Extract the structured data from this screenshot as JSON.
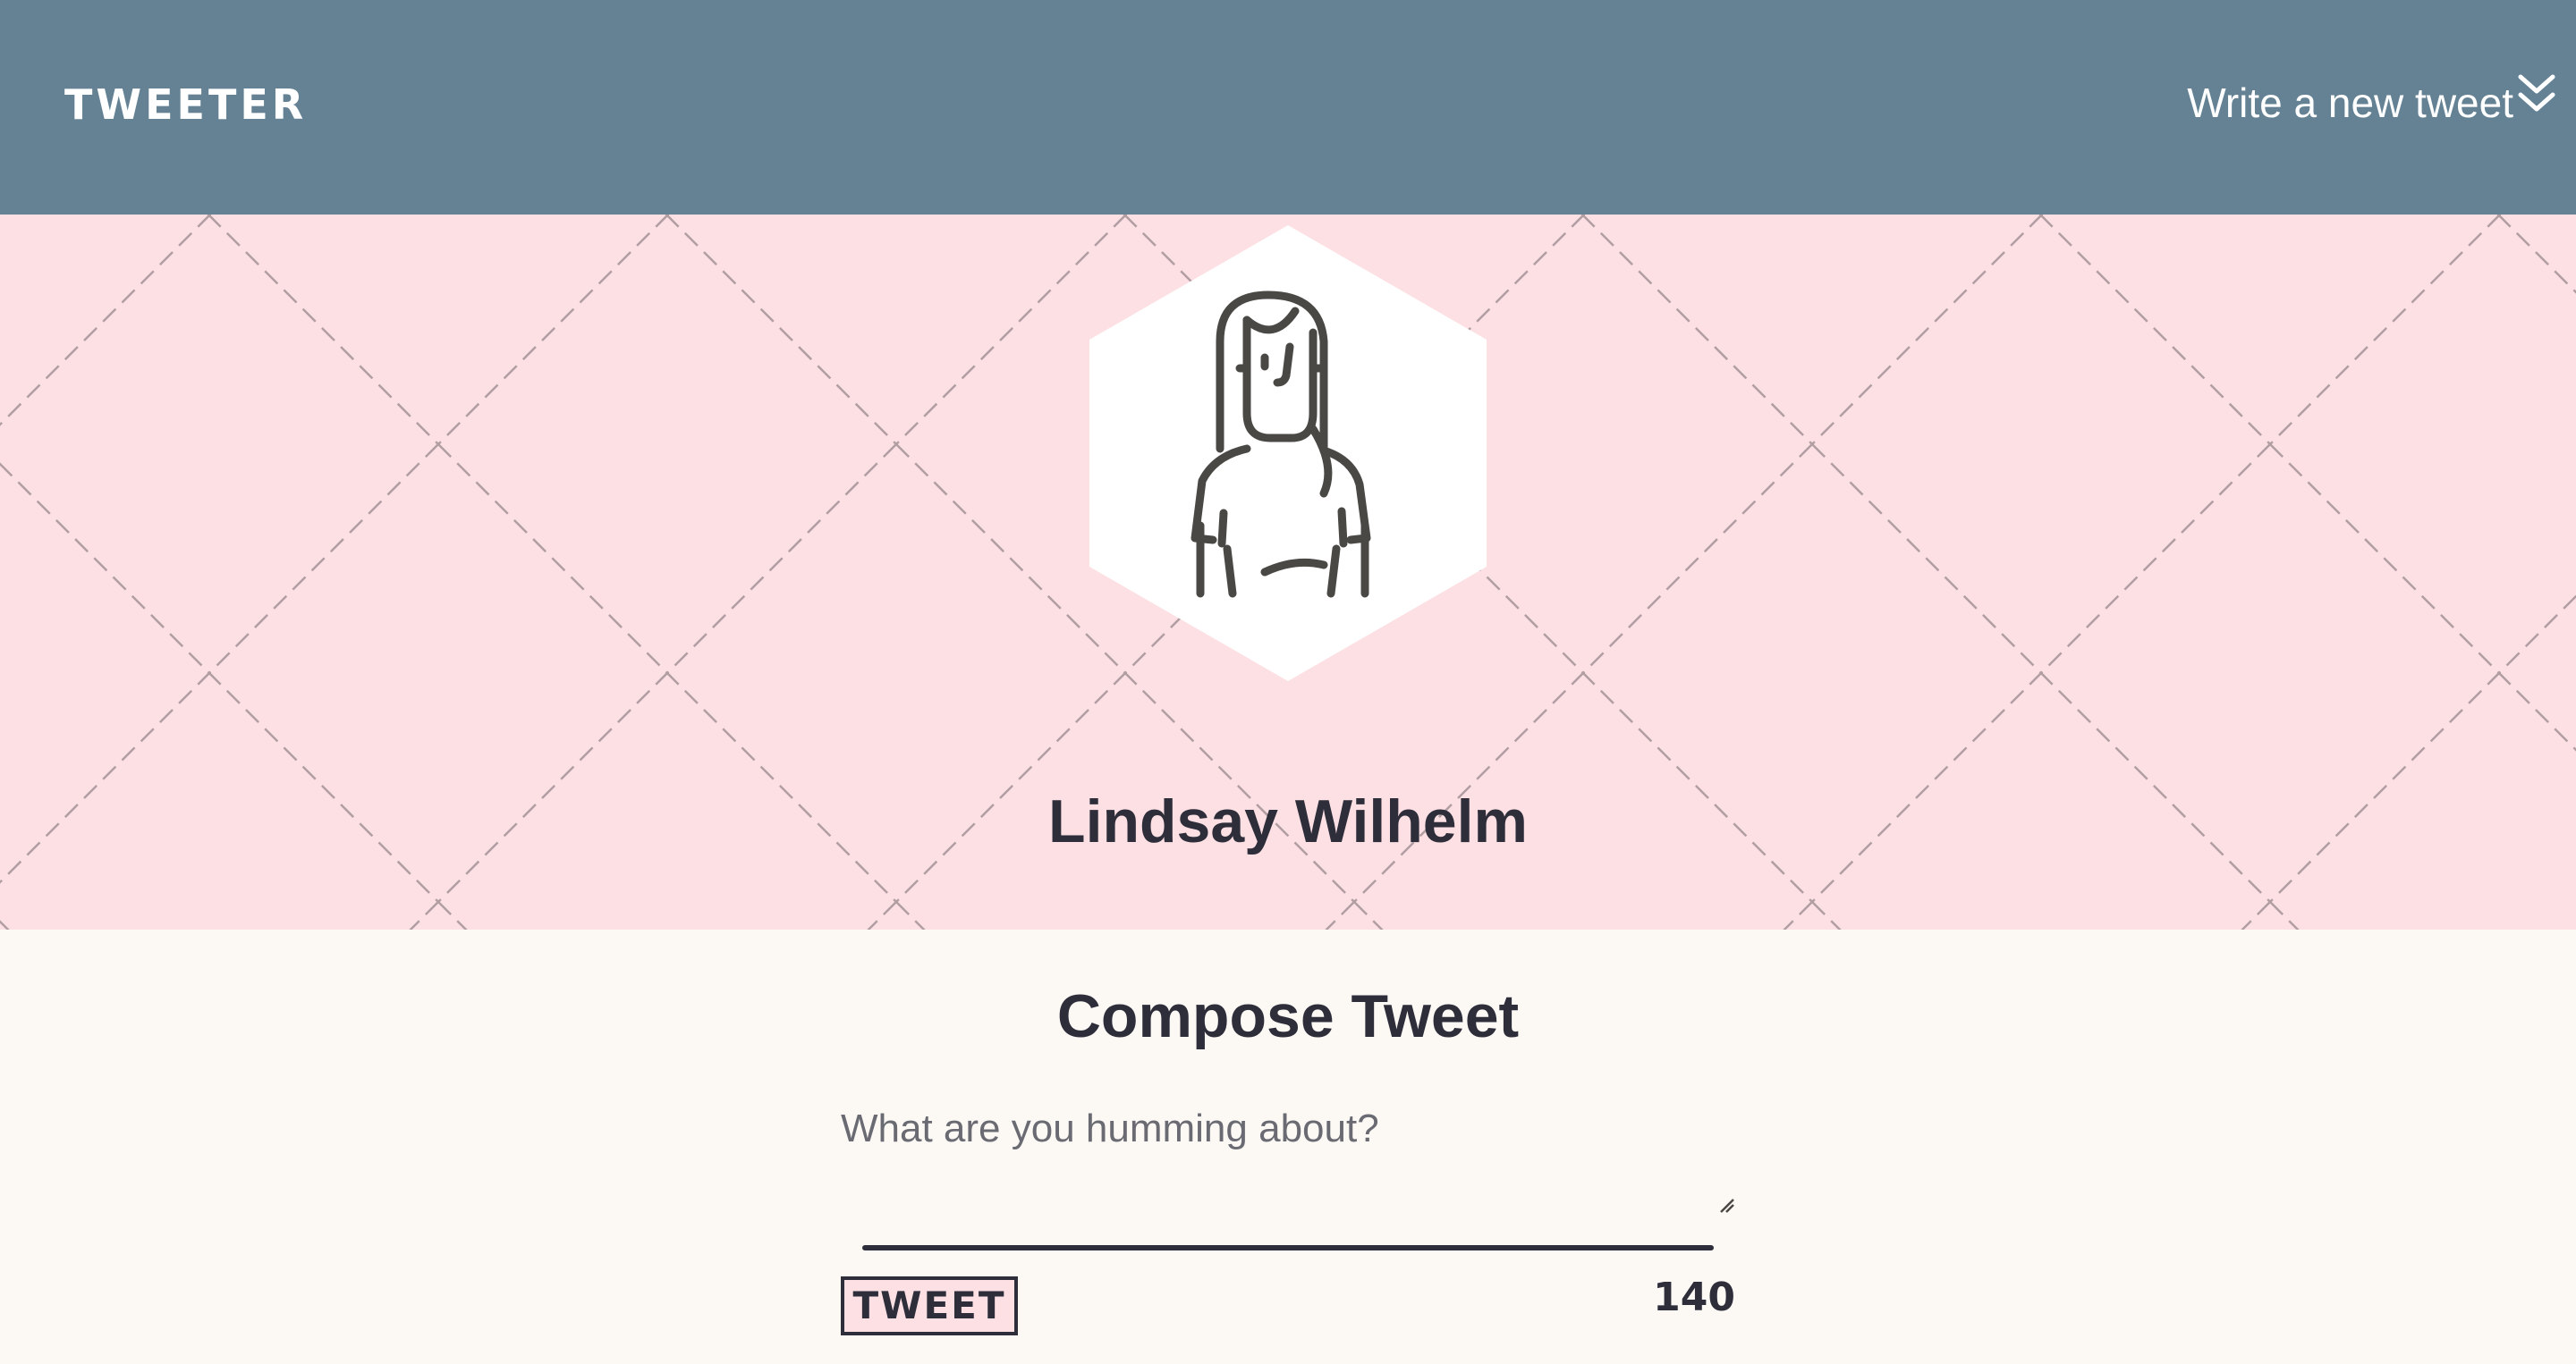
{
  "nav": {
    "brand": "TWEETER",
    "write_label": "Write a new tweet",
    "toggle_icon": "double-chevron-down-icon"
  },
  "profile": {
    "name": "Lindsay Wilhelm",
    "avatar_icon": "woman-avatar-icon",
    "banner_color": "#fde0e4"
  },
  "compose": {
    "title": "Compose Tweet",
    "placeholder": "What are you humming about?",
    "value": "",
    "submit_label": "TWEET",
    "counter": "140"
  },
  "colors": {
    "nav": "#648294",
    "text": "#2e2d3a",
    "page": "#fcf9f5"
  }
}
